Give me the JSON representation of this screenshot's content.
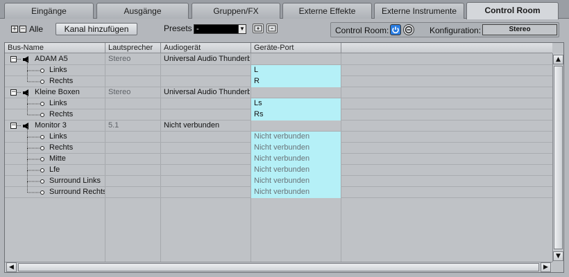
{
  "tabs": [
    {
      "label": "Eingänge",
      "active": false
    },
    {
      "label": "Ausgänge",
      "active": false
    },
    {
      "label": "Gruppen/FX",
      "active": false
    },
    {
      "label": "Externe Effekte",
      "active": false
    },
    {
      "label": "Externe Instrumente",
      "active": false
    },
    {
      "label": "Control Room",
      "active": true
    }
  ],
  "toolbar": {
    "expand_all_symbol": "+",
    "collapse_all_symbol": "−",
    "all_label": "Alle",
    "add_channel_label": "Kanal hinzufügen",
    "presets_label": "Presets",
    "preset_value": "-",
    "control_room_label": "Control Room:",
    "configuration_label": "Konfiguration:",
    "configuration_value": "Stereo"
  },
  "table": {
    "columns": [
      "Bus-Name",
      "Lautsprecher",
      "Audiogerät",
      "Geräte-Port"
    ],
    "rows": [
      {
        "type": "bus",
        "name": "ADAM A5",
        "speaker": "Stereo",
        "device": "Universal Audio Thunderb",
        "port": "",
        "expander": "−"
      },
      {
        "type": "channel",
        "name": "Links",
        "speaker": "",
        "device": "",
        "port": "L",
        "connected": true
      },
      {
        "type": "channel",
        "name": "Rechts",
        "speaker": "",
        "device": "",
        "port": "R",
        "connected": true
      },
      {
        "type": "bus",
        "name": "Kleine Boxen",
        "speaker": "Stereo",
        "device": "Universal Audio Thunderb",
        "port": "",
        "expander": "−"
      },
      {
        "type": "channel",
        "name": "Links",
        "speaker": "",
        "device": "",
        "port": "Ls",
        "connected": true
      },
      {
        "type": "channel",
        "name": "Rechts",
        "speaker": "",
        "device": "",
        "port": "Rs",
        "connected": true
      },
      {
        "type": "bus",
        "name": "Monitor 3",
        "speaker": "5.1",
        "device": "Nicht verbunden",
        "port": "",
        "expander": "−"
      },
      {
        "type": "channel",
        "name": "Links",
        "speaker": "",
        "device": "",
        "port": "Nicht verbunden",
        "connected": false
      },
      {
        "type": "channel",
        "name": "Rechts",
        "speaker": "",
        "device": "",
        "port": "Nicht verbunden",
        "connected": false
      },
      {
        "type": "channel",
        "name": "Mitte",
        "speaker": "",
        "device": "",
        "port": "Nicht verbunden",
        "connected": false
      },
      {
        "type": "channel",
        "name": "Lfe",
        "speaker": "",
        "device": "",
        "port": "Nicht verbunden",
        "connected": false
      },
      {
        "type": "channel",
        "name": "Surround Links",
        "speaker": "",
        "device": "",
        "port": "Nicht verbunden",
        "connected": false
      },
      {
        "type": "channel",
        "name": "Surround Rechts",
        "speaker": "",
        "device": "",
        "port": "Nicht verbunden",
        "connected": false
      }
    ]
  },
  "scroll_arrows": {
    "up": "▲",
    "down": "▼",
    "left": "◀",
    "right": "▶"
  },
  "colors": {
    "port_cell": "#b5f0f7",
    "active_button": "#2a7de1"
  },
  "icons": {
    "bus_icon": "speaker-icon",
    "channel_icon": "plug-icon",
    "power_icon": "power-icon",
    "e_icon": "edit-e-icon"
  }
}
